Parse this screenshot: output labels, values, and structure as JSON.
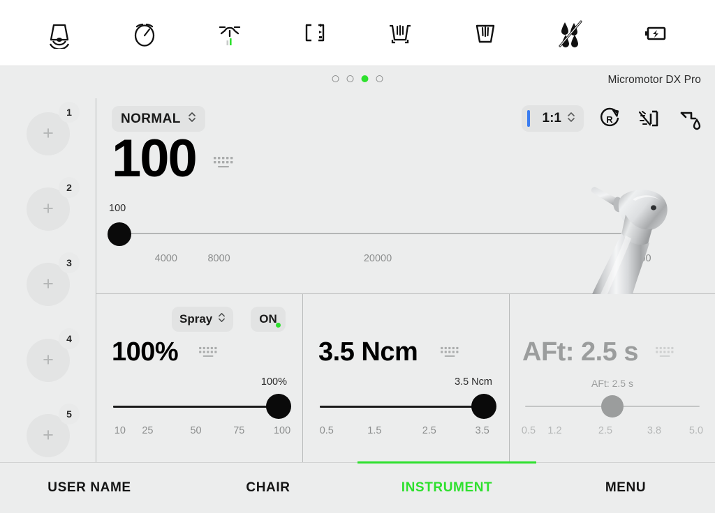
{
  "topbar": {
    "icons": [
      {
        "name": "chair-backrest-icon",
        "label": "Chair position"
      },
      {
        "name": "timer-icon",
        "label": "Timer"
      },
      {
        "name": "operating-light-icon",
        "label": "Operating light"
      },
      {
        "name": "chair-program-icon",
        "label": "Chair program"
      },
      {
        "name": "bowl-rinse-icon",
        "label": "Bowl rinse"
      },
      {
        "name": "cup-fill-icon",
        "label": "Cup fill"
      },
      {
        "name": "water-off-icon",
        "label": "Water off"
      },
      {
        "name": "battery-charge-icon",
        "label": "Battery charge"
      }
    ]
  },
  "header": {
    "device_name": "Micromotor DX Pro",
    "page_dots": 4,
    "active_dot_index": 2
  },
  "sidebar": {
    "presets": [
      {
        "number": "1",
        "icon": "plus-icon"
      },
      {
        "number": "2",
        "icon": "plus-icon"
      },
      {
        "number": "3",
        "icon": "plus-icon"
      },
      {
        "number": "4",
        "icon": "plus-icon"
      },
      {
        "number": "5",
        "icon": "plus-icon"
      }
    ]
  },
  "speed": {
    "mode_label": "NORMAL",
    "value": "100",
    "keypad_icon": "keypad-icon",
    "slider_value_label": "100",
    "slider_percent": 1.5,
    "ticks": [
      {
        "label": "4000",
        "pos": 10
      },
      {
        "label": "8000",
        "pos": 20
      },
      {
        "label": "20000",
        "pos": 50
      },
      {
        "label": "40000",
        "pos": 99
      }
    ],
    "ratio_label": "1:1",
    "ratio_accent": "#3b7df0",
    "tools": [
      {
        "name": "rotation-direction-icon",
        "label": "Rotation direction"
      },
      {
        "name": "spray-mode-icon",
        "label": "Spray mode"
      },
      {
        "name": "water-drop-icon",
        "label": "Water drop"
      }
    ]
  },
  "spray_panel": {
    "dropdown_label": "Spray",
    "toggle_label": "ON",
    "toggle_indicator_color": "#2ee02e",
    "value": "100%",
    "keypad_icon": "keypad-icon",
    "slider_value_label": "100%",
    "slider_percent": 100,
    "ticks": [
      {
        "label": "10",
        "pos": 4
      },
      {
        "label": "25",
        "pos": 20
      },
      {
        "label": "50",
        "pos": 48
      },
      {
        "label": "75",
        "pos": 73
      },
      {
        "label": "100",
        "pos": 98
      }
    ]
  },
  "torque_panel": {
    "value": "3.5 Ncm",
    "keypad_icon": "keypad-icon",
    "slider_value_label": "3.5 Ncm",
    "slider_percent": 100,
    "ticks": [
      {
        "label": "0.5",
        "pos": 4
      },
      {
        "label": "1.5",
        "pos": 32
      },
      {
        "label": "2.5",
        "pos": 64
      },
      {
        "label": "3.5",
        "pos": 95
      }
    ]
  },
  "aft_panel": {
    "enabled": false,
    "value": "AFt: 2.5 s",
    "keypad_icon": "keypad-icon",
    "slider_value_label": "AFt: 2.5 s",
    "slider_percent": 46,
    "ticks": [
      {
        "label": "0.5",
        "pos": 2
      },
      {
        "label": "1.2",
        "pos": 17
      },
      {
        "label": "2.5",
        "pos": 46
      },
      {
        "label": "3.8",
        "pos": 74
      },
      {
        "label": "5.0",
        "pos": 98
      }
    ]
  },
  "navbar": {
    "items": [
      {
        "label": "USER NAME",
        "active": false
      },
      {
        "label": "CHAIR",
        "active": false
      },
      {
        "label": "INSTRUMENT",
        "active": true
      },
      {
        "label": "MENU",
        "active": false
      }
    ],
    "active_color": "#2ee02e"
  },
  "handpiece": {
    "name": "dental-handpiece-image"
  }
}
